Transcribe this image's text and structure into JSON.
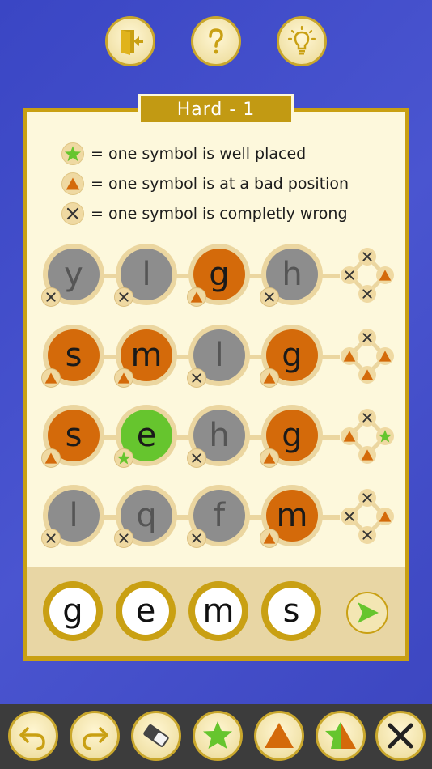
{
  "level_title": "Hard - 1",
  "legend": [
    {
      "icon": "star-icon",
      "text": "= one symbol is well placed"
    },
    {
      "icon": "triangle-icon",
      "text": "= one symbol is at a bad position"
    },
    {
      "icon": "cross-icon",
      "text": "= one symbol is completly wrong"
    }
  ],
  "guesses": [
    {
      "pegs": [
        {
          "letter": "y",
          "state": "wrong"
        },
        {
          "letter": "l",
          "state": "wrong"
        },
        {
          "letter": "g",
          "state": "misplaced"
        },
        {
          "letter": "h",
          "state": "wrong"
        }
      ],
      "clues": [
        "wrong",
        "wrong",
        "misplaced",
        "wrong"
      ]
    },
    {
      "pegs": [
        {
          "letter": "s",
          "state": "misplaced"
        },
        {
          "letter": "m",
          "state": "misplaced"
        },
        {
          "letter": "l",
          "state": "wrong"
        },
        {
          "letter": "g",
          "state": "misplaced"
        }
      ],
      "clues": [
        "wrong",
        "misplaced",
        "misplaced",
        "misplaced"
      ]
    },
    {
      "pegs": [
        {
          "letter": "s",
          "state": "misplaced"
        },
        {
          "letter": "e",
          "state": "correct"
        },
        {
          "letter": "h",
          "state": "wrong"
        },
        {
          "letter": "g",
          "state": "misplaced"
        }
      ],
      "clues": [
        "wrong",
        "misplaced",
        "correct",
        "misplaced"
      ]
    },
    {
      "pegs": [
        {
          "letter": "l",
          "state": "wrong"
        },
        {
          "letter": "q",
          "state": "wrong"
        },
        {
          "letter": "f",
          "state": "wrong"
        },
        {
          "letter": "m",
          "state": "misplaced"
        }
      ],
      "clues": [
        "wrong",
        "wrong",
        "misplaced",
        "wrong"
      ]
    }
  ],
  "current_input": [
    "g",
    "e",
    "m",
    "s"
  ],
  "colors": {
    "correct": "#66c52e",
    "misplaced": "#d46a0a",
    "wrong": "#8d8d8d",
    "gold": "#c9a013"
  },
  "top_buttons": [
    "exit-door-icon",
    "help-question-icon",
    "hint-lightbulb-icon"
  ],
  "toolbar": [
    "undo-icon",
    "redo-icon",
    "eraser-icon",
    "star-icon",
    "triangle-icon",
    "star-triangle-icon",
    "cross-icon"
  ]
}
